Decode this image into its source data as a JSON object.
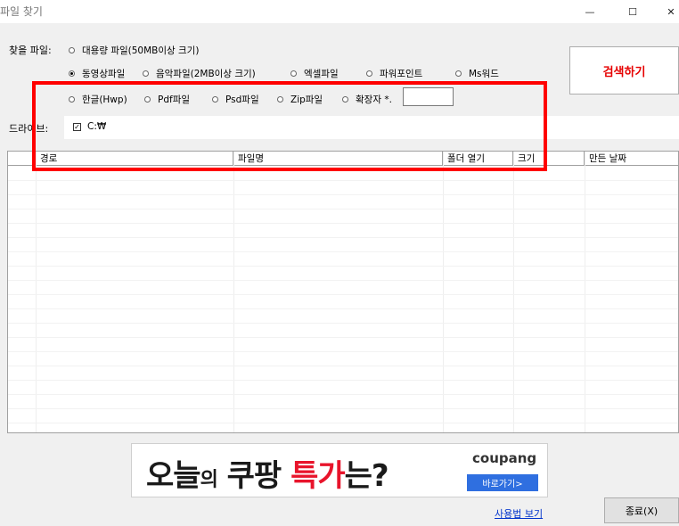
{
  "window": {
    "title": "파일 찾기",
    "minimize_glyph": "—",
    "maximize_glyph": "☐",
    "close_glyph": "✕"
  },
  "search_section": {
    "label": "찾을 파일:",
    "options": [
      {
        "label": "대용량 파일(50MB이상 크기)",
        "selected": false
      },
      {
        "label": "동영상파일",
        "selected": true
      },
      {
        "label": "음악파일(2MB이상 크기)",
        "selected": false
      },
      {
        "label": "엑셀파일",
        "selected": false
      },
      {
        "label": "파워포인트",
        "selected": false
      },
      {
        "label": "Ms워드",
        "selected": false
      },
      {
        "label": "한글(Hwp)",
        "selected": false
      },
      {
        "label": "Pdf파일",
        "selected": false
      },
      {
        "label": "Psd파일",
        "selected": false
      },
      {
        "label": "Zip파일",
        "selected": false
      },
      {
        "label": "확장자 *.",
        "selected": false
      }
    ],
    "extension_value": "",
    "search_button": "검색하기"
  },
  "drive_section": {
    "label": "드라이브:",
    "drive_label": "C:₩",
    "checked": true,
    "check_glyph": "✓"
  },
  "results_table": {
    "columns": [
      "경로",
      "파일명",
      "폴더 열기",
      "크기",
      "만든 날짜"
    ],
    "rows": []
  },
  "ad": {
    "part1": "오늘",
    "part2": "의",
    "part3": "쿠팡",
    "part4": "특가",
    "part5": "는?",
    "brand": "coupang",
    "button": "바로가기>"
  },
  "footer": {
    "help_link": "사용법 보기",
    "close_button": "종료(X)"
  },
  "colors": {
    "highlight_box": "#ff0000",
    "search_text": "#e60000"
  }
}
